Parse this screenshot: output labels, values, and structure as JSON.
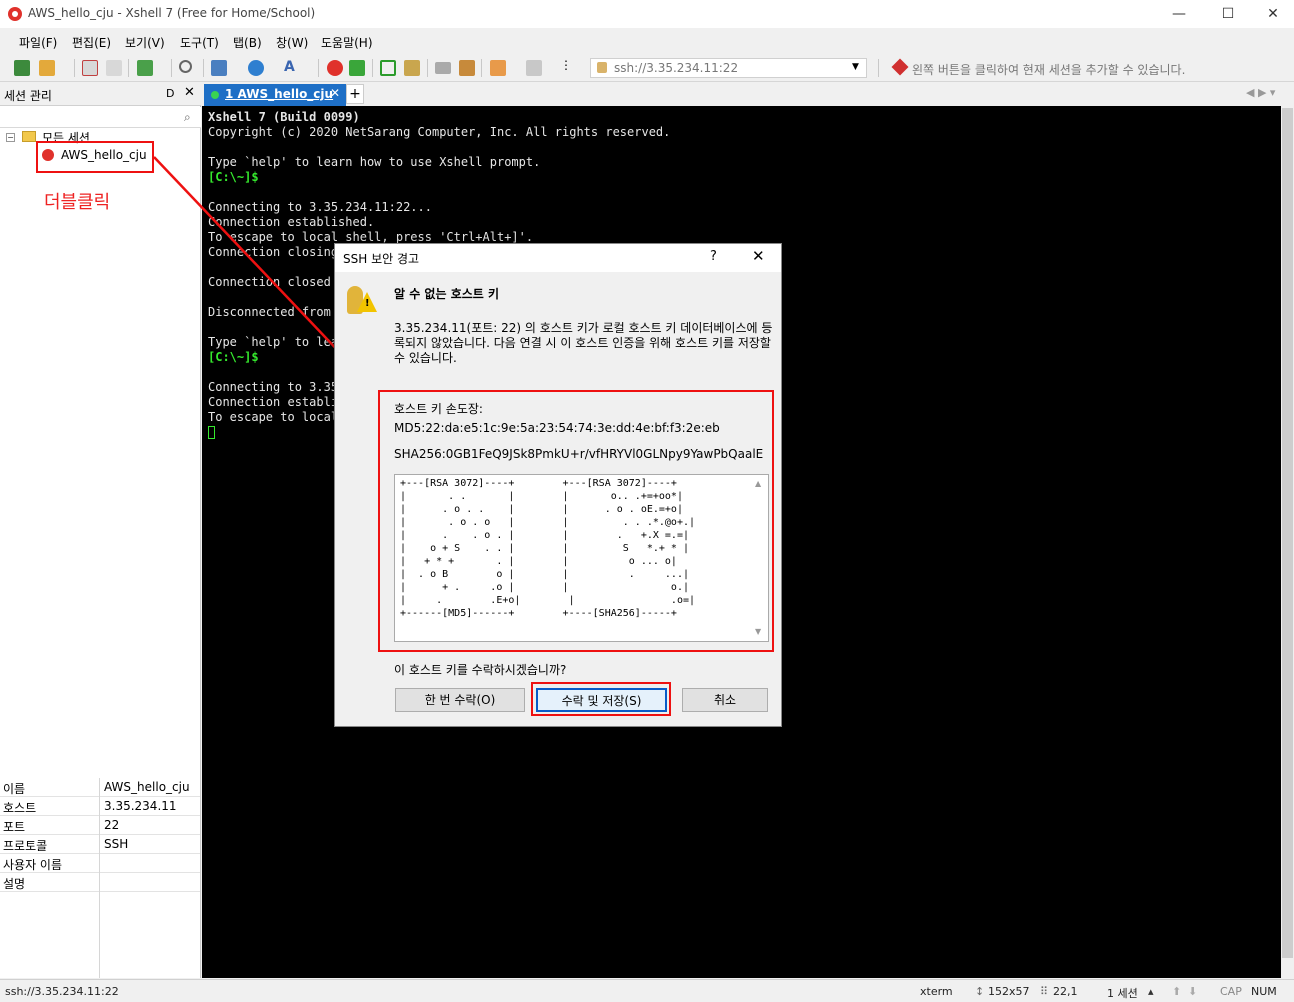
{
  "window": {
    "title": "AWS_hello_cju - Xshell 7 (Free for Home/School)",
    "minimize": "—",
    "maximize": "☐",
    "close": "✕"
  },
  "menu": [
    "파일(F)",
    "편집(E)",
    "보기(V)",
    "도구(T)",
    "탭(B)",
    "창(W)",
    "도움말(H)"
  ],
  "toolbar": {
    "address": "ssh://3.35.234.11:22",
    "hint": "왼쪽 버튼을 클릭하여 현재 세션을 추가할 수 있습니다."
  },
  "sidebar": {
    "title": "세션 관리",
    "pin": "ᗞ",
    "close": "✕",
    "tree_root": "모든 세션",
    "tree_session": "AWS_hello_cju",
    "annotation": "더블클릭",
    "properties": [
      {
        "key": "이름",
        "value": "AWS_hello_cju"
      },
      {
        "key": "호스트",
        "value": "3.35.234.11"
      },
      {
        "key": "포트",
        "value": "22"
      },
      {
        "key": "프로토콜",
        "value": "SSH"
      },
      {
        "key": "사용자 이름",
        "value": ""
      },
      {
        "key": "설명",
        "value": ""
      }
    ]
  },
  "tabs": {
    "active_label": "1 AWS_hello_cju",
    "close": "✕",
    "add": "+"
  },
  "terminal": {
    "lines": [
      {
        "text": "Xshell 7 (Build 0099)",
        "style": "bold"
      },
      {
        "text": "Copyright (c) 2020 NetSarang Computer, Inc. All rights reserved.",
        "style": ""
      },
      {
        "text": "",
        "style": ""
      },
      {
        "text": "Type `help' to learn how to use Xshell prompt.",
        "style": ""
      },
      {
        "text": "[C:\\~]$",
        "style": "green"
      },
      {
        "text": "",
        "style": ""
      },
      {
        "text": "Connecting to 3.35.234.11:22...",
        "style": ""
      },
      {
        "text": "Connection established.",
        "style": ""
      },
      {
        "text": "To escape to local shell, press 'Ctrl+Alt+]'.",
        "style": ""
      },
      {
        "text": "Connection closing",
        "style": ""
      },
      {
        "text": "",
        "style": ""
      },
      {
        "text": "Connection closed",
        "style": ""
      },
      {
        "text": "",
        "style": ""
      },
      {
        "text": "Disconnected from",
        "style": ""
      },
      {
        "text": "",
        "style": ""
      },
      {
        "text": "Type `help' to lea",
        "style": ""
      },
      {
        "text": "[C:\\~]$",
        "style": "green"
      },
      {
        "text": "",
        "style": ""
      },
      {
        "text": "Connecting to 3.35",
        "style": ""
      },
      {
        "text": "Connection establi",
        "style": ""
      },
      {
        "text": "To escape to local",
        "style": ""
      }
    ]
  },
  "dialog": {
    "title": "SSH 보안 경고",
    "help": "?",
    "close": "✕",
    "heading": "알 수 없는 호스트 키",
    "description": "3.35.234.11(포트: 22) 의 호스트 키가 로컬 호스트 키 데이터베이스에 등록되지 않았습니다. 다음 연결 시 이 호스트 인증을 위해 호스트 키를 저장할 수 있습니다.",
    "fingerprint_label": "호스트 키 손도장:",
    "md5": "MD5:22:da:e5:1c:9e:5a:23:54:74:3e:dd:4e:bf:f3:2e:eb",
    "sha256": "SHA256:0GB1FeQ9JSk8PmkU+r/vfHRYVl0GLNpy9YawPbQaalE",
    "randomart": "+---[RSA 3072]----+        +---[RSA 3072]----+\n|       . .       |        |       o.. .+=+oo*|\n|      . o . .    |        |      . o . oE.=+o|\n|       . o . o   |        |         . . .*.@o+.|\n|      .    . o . |        |        .   +.X =.=|\n|    o + S    . . |        |         S   *.+ * |\n|   + * +       . |        |          o ... o|\n|  . o B        o |        |          .     ...|\n|      + .     .o |        |                 o.|\n|     .        .E+o|        |                .o=|\n+------[MD5]------+        +----[SHA256]-----+",
    "question": "이 호스트 키를 수락하시겠습니까?",
    "btn_once": "한 번 수락(O)",
    "btn_save": "수락 및 저장(S)",
    "btn_cancel": "취소"
  },
  "status": {
    "address": "ssh://3.35.234.11:22",
    "term": "xterm",
    "size": "152x57",
    "pos": "22,1",
    "sessions": "1 세션",
    "cap": "CAP",
    "num": "NUM"
  },
  "colors": {
    "tab_active": "#1e6fc6",
    "prompt_green": "#35e82d",
    "annotation_red": "#e11111"
  }
}
